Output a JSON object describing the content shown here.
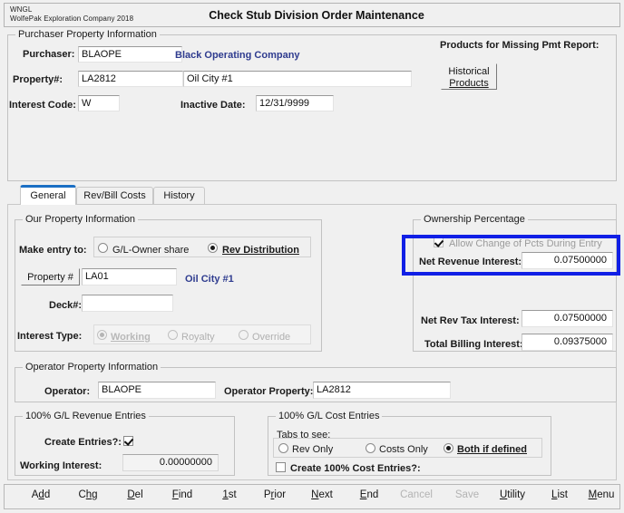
{
  "window": {
    "brand_line1": "WNGL",
    "brand_line2": "WolfePak Exploration Company 2018",
    "title": "Check Stub Division Order Maintenance"
  },
  "purchaser_group": {
    "legend": "Purchaser Property Information",
    "purchaser_label": "Purchaser:",
    "purchaser_value": "BLAOPE",
    "purchaser_name": "Black Operating Company",
    "property_label": "Property#:",
    "property_value": "LA2812",
    "property_name": "Oil City #1",
    "interest_code_label": "Interest Code:",
    "interest_code_value": "W",
    "inactive_date_label": "Inactive Date:",
    "inactive_date_value": "12/31/9999",
    "products_label": "Products for Missing Pmt Report:",
    "historical_products_line1": "Historical",
    "historical_products_line2": "Products"
  },
  "tabs": [
    {
      "label": "General",
      "active": true
    },
    {
      "label": "Rev/Bill Costs",
      "active": false
    },
    {
      "label": "History",
      "active": false
    }
  ],
  "our_property_group": {
    "legend": "Our Property Information",
    "make_entry_label": "Make entry to:",
    "entry_option_1": "G/L-Owner share",
    "entry_option_2": "Rev Distribution",
    "property_button": "Property #",
    "property_value": "LA01",
    "property_name": "Oil City #1",
    "deck_label": "Deck#:",
    "deck_value": "",
    "interest_type_label": "Interest Type:",
    "interest_type_1": "Working",
    "interest_type_2": "Royalty",
    "interest_type_3": "Override"
  },
  "ownership_group": {
    "legend": "Ownership Percentage",
    "allow_change_label": "Allow Change of Pcts During Entry",
    "net_revenue_label": "Net Revenue Interest:",
    "net_revenue_value": "0.07500000",
    "net_rev_tax_label": "Net Rev Tax Interest:",
    "net_rev_tax_value": "0.07500000",
    "total_billing_label": "Total Billing Interest:",
    "total_billing_value": "0.09375000",
    "highlight_color": "#101fe6"
  },
  "operator_group": {
    "legend": "Operator Property Information",
    "operator_label": "Operator:",
    "operator_value": "BLAOPE",
    "operator_property_label": "Operator Property:",
    "operator_property_value": "LA2812"
  },
  "revenue_entries_group": {
    "legend": "100% G/L Revenue Entries",
    "create_entries_label": "Create Entries?:",
    "create_entries_checked": true,
    "working_interest_label": "Working Interest:",
    "working_interest_value": "0.00000000"
  },
  "cost_entries_group": {
    "legend": "100% G/L Cost Entries",
    "tabs_to_see_label": "Tabs to see:",
    "tabs_option_1": "Rev Only",
    "tabs_option_2": "Costs Only",
    "tabs_option_3": "Both if defined",
    "create_cost_label": "Create 100% Cost Entries?:",
    "create_cost_checked": false
  },
  "command_bar": {
    "buttons": [
      {
        "pre": "A",
        "key": "d",
        "post": "d",
        "disabled": false
      },
      {
        "pre": "C",
        "key": "h",
        "post": "g",
        "disabled": false
      },
      {
        "pre": "",
        "key": "D",
        "post": "el",
        "disabled": false
      },
      {
        "pre": "",
        "key": "F",
        "post": "ind",
        "disabled": false
      },
      {
        "pre": "",
        "key": "1",
        "post": "st",
        "disabled": false
      },
      {
        "pre": "P",
        "key": "r",
        "post": "ior",
        "disabled": false
      },
      {
        "pre": "",
        "key": "N",
        "post": "ext",
        "disabled": false
      },
      {
        "pre": "",
        "key": "E",
        "post": "nd",
        "disabled": false
      },
      {
        "pre": "",
        "key": "",
        "post": "Cancel",
        "disabled": true
      },
      {
        "pre": "",
        "key": "",
        "post": "Save",
        "disabled": true
      },
      {
        "pre": "",
        "key": "U",
        "post": "tility",
        "disabled": false
      },
      {
        "pre": "",
        "key": "L",
        "post": "ist",
        "disabled": false
      },
      {
        "pre": "",
        "key": "M",
        "post": "enu",
        "disabled": false
      }
    ]
  }
}
